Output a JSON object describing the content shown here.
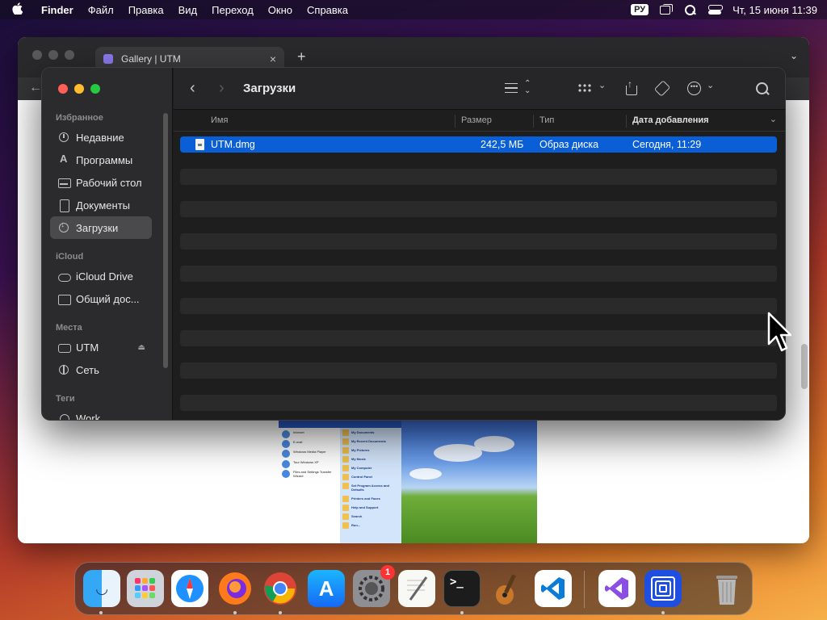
{
  "menubar": {
    "apple_icon": "apple-logo-icon",
    "app_name": "Finder",
    "items": [
      "Файл",
      "Правка",
      "Вид",
      "Переход",
      "Окно",
      "Справка"
    ],
    "lang": "РУ",
    "datetime": "Чт, 15 июня  11:39"
  },
  "browser": {
    "tab_title": "Gallery | UTM",
    "tab_close": "×",
    "new_tab": "+",
    "tab_menu": "⌄",
    "back": "←",
    "xp_left_entries": [
      "Internet",
      "E-mail",
      "Windows Media Player",
      "Tour Windows XP",
      "Files and Settings Transfer Wizard"
    ],
    "xp_right_entries": [
      "My Documents",
      "My Recent Documents",
      "My Pictures",
      "My Music",
      "My Computer",
      "Control Panel",
      "Set Program Access and Defaults",
      "Printers and Faxes",
      "Help and Support",
      "Search",
      "Run..."
    ]
  },
  "finder": {
    "folder_title": "Загрузки",
    "nav": {
      "back": "‹",
      "forward": "›"
    },
    "sidebar": {
      "sections": [
        {
          "title": "Избранное",
          "items": [
            {
              "label": "Недавние",
              "icon": "clock-icon"
            },
            {
              "label": "Программы",
              "icon": "applications-icon"
            },
            {
              "label": "Рабочий стол",
              "icon": "desktop-icon"
            },
            {
              "label": "Документы",
              "icon": "document-icon"
            },
            {
              "label": "Загрузки",
              "icon": "downloads-icon",
              "selected": true
            }
          ]
        },
        {
          "title": "iCloud",
          "items": [
            {
              "label": "iCloud Drive",
              "icon": "cloud-icon"
            },
            {
              "label": "Общий дос...",
              "icon": "shared-folder-icon"
            }
          ]
        },
        {
          "title": "Места",
          "items": [
            {
              "label": "UTM",
              "icon": "drive-icon",
              "eject": "⏏"
            },
            {
              "label": "Сеть",
              "icon": "globe-icon"
            }
          ]
        },
        {
          "title": "Теги",
          "items": [
            {
              "label": "Work",
              "icon": "tag-icon"
            }
          ]
        }
      ]
    },
    "columns": {
      "name": "Имя",
      "size": "Размер",
      "kind": "Тип",
      "date_added": "Дата добавления"
    },
    "files": [
      {
        "name": "UTM.dmg",
        "size": "242,5 МБ",
        "kind": "Образ диска",
        "date_added": "Сегодня, 11:29",
        "selected": true
      }
    ]
  },
  "dock": {
    "apps": [
      "Finder",
      "Launchpad",
      "Safari",
      "Firefox",
      "Chrome",
      "App Store",
      "System Settings",
      "TextEdit",
      "Terminal",
      "GarageBand",
      "Visual Studio Code",
      "Visual Studio",
      "UTM",
      "Trash"
    ],
    "system_settings_badge": "1",
    "terminal_glyph": ">_"
  },
  "colors": {
    "selection": "#0a5fd6",
    "finder_bg": "#1e1e1e",
    "sidebar_bg": "#2b2b2d"
  }
}
